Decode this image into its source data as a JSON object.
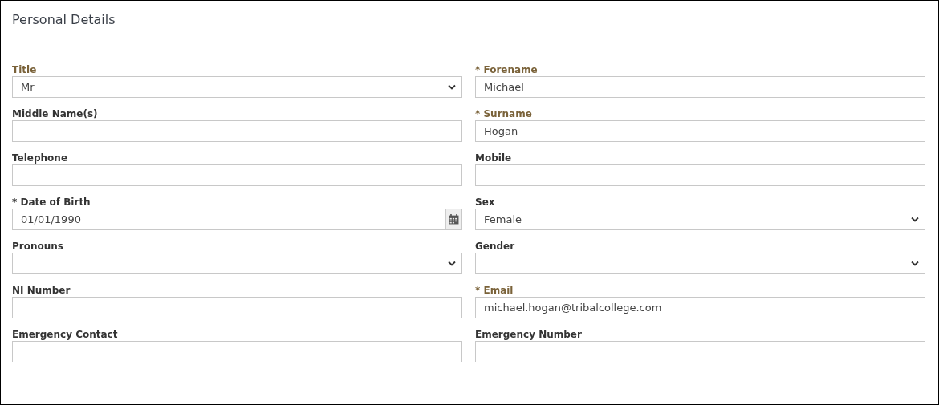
{
  "heading": "Personal Details",
  "fields": [
    {
      "label": "Title",
      "kind": "select",
      "value": "Mr",
      "emphasized": true
    },
    {
      "label": "* Forename",
      "kind": "text",
      "value": "Michael",
      "emphasized": true
    },
    {
      "label": "Middle Name(s)",
      "kind": "text",
      "emphasized": false
    },
    {
      "label": "* Surname",
      "kind": "text",
      "value": "Hogan",
      "emphasized": true
    },
    {
      "label": "Telephone",
      "kind": "text",
      "emphasized": false
    },
    {
      "label": "Mobile",
      "kind": "text",
      "emphasized": false
    },
    {
      "label": "* Date of Birth",
      "kind": "date",
      "value": "01/01/1990",
      "emphasized": false
    },
    {
      "label": "Sex",
      "kind": "select",
      "value": "Female",
      "emphasized": false
    },
    {
      "label": "Pronouns",
      "kind": "select",
      "emphasized": false
    },
    {
      "label": "Gender",
      "kind": "select",
      "emphasized": false
    },
    {
      "label": "NI Number",
      "kind": "text",
      "emphasized": false
    },
    {
      "label": "* Email",
      "kind": "text",
      "value": "michael.hogan@tribalcollege.com",
      "emphasized": true
    },
    {
      "label": "Emergency Contact",
      "kind": "text",
      "emphasized": false
    },
    {
      "label": "Emergency Number",
      "kind": "text",
      "emphasized": false
    }
  ]
}
